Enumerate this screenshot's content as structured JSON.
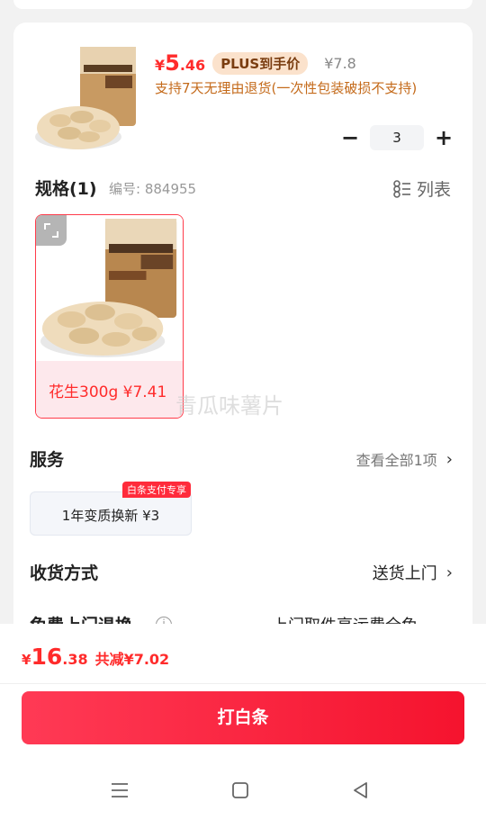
{
  "product": {
    "price_currency": "¥",
    "price_integer": "5",
    "price_decimal": ".46",
    "plus_tag": "PLUS到手价",
    "original_price": "¥7.8",
    "return_note": "支持7天无理由退货(一次性包装破损不支持)",
    "quantity": "3",
    "minus_label": "−",
    "plus_label": "+"
  },
  "spec": {
    "title": "规格(1)",
    "code": "编号: 884955",
    "list_label": "列表",
    "option_label": "花生300g ¥7.41"
  },
  "watermark": "青瓜味薯片",
  "service": {
    "title": "服务",
    "view_all": "查看全部1项",
    "chip": "1年变质换新  ¥3",
    "badge": "白条支付专享"
  },
  "delivery": {
    "title": "收货方式",
    "value": "送货上门"
  },
  "free_return": {
    "title": "免费上门退换",
    "value": "上门取件享运费全免"
  },
  "footer": {
    "total_currency": "¥",
    "total_integer": "16",
    "total_decimal": ".38",
    "total_saved": "共减¥7.02",
    "pay_button": "打白条"
  },
  "colors": {
    "accent": "#ff2b2b",
    "pay_gradient_start": "#ff3a55",
    "pay_gradient_end": "#f5132e",
    "plus_tag_bg": "#fbe2cc",
    "return_note": "#c46a1a"
  },
  "icons": [
    "expand-icon",
    "list-icon",
    "chevron-right-icon",
    "info-icon",
    "menu-icon",
    "home-square-icon",
    "back-triangle-icon"
  ]
}
